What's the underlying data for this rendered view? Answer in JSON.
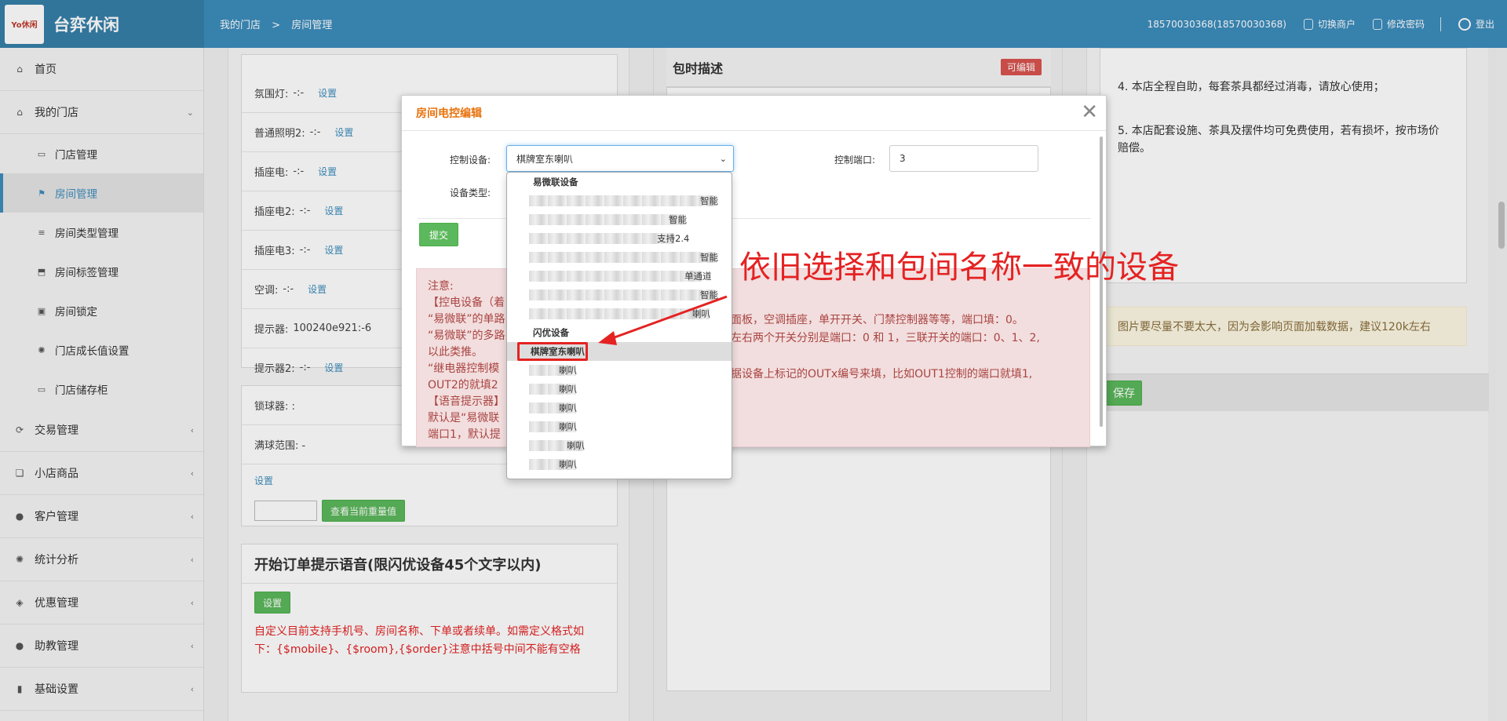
{
  "header": {
    "brand": "台弈休闲",
    "logo_text": "Yo休闲",
    "breadcrumb": [
      "我的门店",
      ">",
      "房间管理"
    ],
    "account": "18570030368(18570030368)",
    "switch_label": "切换商户",
    "password_label": "修改密码",
    "logout_label": "登出"
  },
  "sidebar": {
    "items": [
      {
        "label": "首页",
        "icon": "home-icon"
      },
      {
        "label": "我的门店",
        "icon": "home-icon",
        "chev": "⌄"
      },
      {
        "label": "门店管理",
        "icon": "inbox-icon"
      },
      {
        "label": "房间管理",
        "icon": "flag-icon"
      },
      {
        "label": "房间类型管理",
        "icon": "list-icon"
      },
      {
        "label": "房间标签管理",
        "icon": "bookmark-icon"
      },
      {
        "label": "房间锁定",
        "icon": "lock-icon"
      },
      {
        "label": "门店成长值设置",
        "icon": "gear-icon"
      },
      {
        "label": "门店储存柜",
        "icon": "inbox-icon"
      },
      {
        "label": "交易管理",
        "icon": "refresh-icon",
        "chev": "‹"
      },
      {
        "label": "小店商品",
        "icon": "gift-icon",
        "chev": "‹"
      },
      {
        "label": "客户管理",
        "icon": "user-icon",
        "chev": "‹"
      },
      {
        "label": "统计分析",
        "icon": "gear-icon",
        "chev": "‹"
      },
      {
        "label": "优惠管理",
        "icon": "tags-icon",
        "chev": "‹"
      },
      {
        "label": "助教管理",
        "icon": "user-icon",
        "chev": "‹"
      },
      {
        "label": "基础设置",
        "icon": "barcode-icon",
        "chev": "‹"
      }
    ]
  },
  "devices": {
    "rows": [
      {
        "name": "氛围灯:",
        "value": "-:-",
        "link": "设置"
      },
      {
        "name": "普通照明2:",
        "value": "-:-",
        "link": "设置"
      },
      {
        "name": "插座电:",
        "value": "-:-",
        "link": "设置"
      },
      {
        "name": "插座电2:",
        "value": "-:-",
        "link": "设置"
      },
      {
        "name": "插座电3:",
        "value": "-:-",
        "link": "设置"
      },
      {
        "name": "空调:",
        "value": "-:-",
        "link": "设置"
      },
      {
        "name": "提示器:",
        "value": "100240e921:-6",
        "link": ""
      },
      {
        "name": "提示器2:",
        "value": "-:-",
        "link": "设置"
      }
    ]
  },
  "lock": {
    "ball_label": "锁球器: :",
    "range_label": "满球范围: -",
    "set_link": "设置",
    "query_button": "查看当前重量值"
  },
  "voice": {
    "title": "开始订单提示语音(限闪优设备45个文字以内)",
    "set_button": "设置",
    "hint": "自定义目前支持手机号、房间名称、下单或者续单。如需定义格式如下：{$mobile}、{$room},{$order}注意中括号中间不能有空格"
  },
  "middle": {
    "title": "包时描述",
    "badge": "可编辑"
  },
  "right": {
    "line4": "4. 本店全程自助，每套茶具都经过消毒，请放心使用；",
    "line5": "5. 本店配套设施、茶具及摆件均可免费使用，若有损坏，按市场价赔偿。",
    "warn": "图片要尽量不要太大，因为会影响页面加载数据，建议120k左右",
    "save_button": "保存"
  },
  "modal": {
    "title": "房间电控编辑",
    "device_label": "控制设备:",
    "device_value": "棋牌室东喇叭",
    "type_label": "设备类型:",
    "port_label": "控制端口:",
    "port_value": "3",
    "submit": "提交",
    "note_left": [
      "注意:",
      "【控电设备（着",
      "“易微联”的单路",
      "“易微联”的多路",
      "以此类推。",
      "“继电器控制模",
      "OUT2的就填2",
      "【语音提示器】",
      "默认是“易微联",
      "端口1，默认提"
    ],
    "note_right": [
      "面板，空调插座，单开开关、门禁控制器等等，端口填：0。",
      "左右两个开关分别是端口：0 和 1，三联开关的端口：0、1、2,",
      "",
      "据设备上标记的OUTx编号来填，比如OUT1控制的端口就填1,"
    ]
  },
  "dropdown": {
    "groups": [
      {
        "label": "易微联设备",
        "options": [
          "智能",
          "智能",
          "支持2.4",
          "智能",
          "单通道",
          "智能",
          "喇叭"
        ]
      },
      {
        "label": "闪优设备",
        "options": [
          "棋牌室东喇叭",
          "喇叭",
          "喇叭",
          "喇叭",
          "喇叭",
          "喇叭",
          "喇叭"
        ]
      }
    ],
    "selected": "棋牌室东喇叭"
  },
  "annotation": "依旧选择和包间名称一致的设备",
  "colors": {
    "brand": "#3c8dbc",
    "annotation": "#e52222",
    "warning": "#e8720c"
  }
}
